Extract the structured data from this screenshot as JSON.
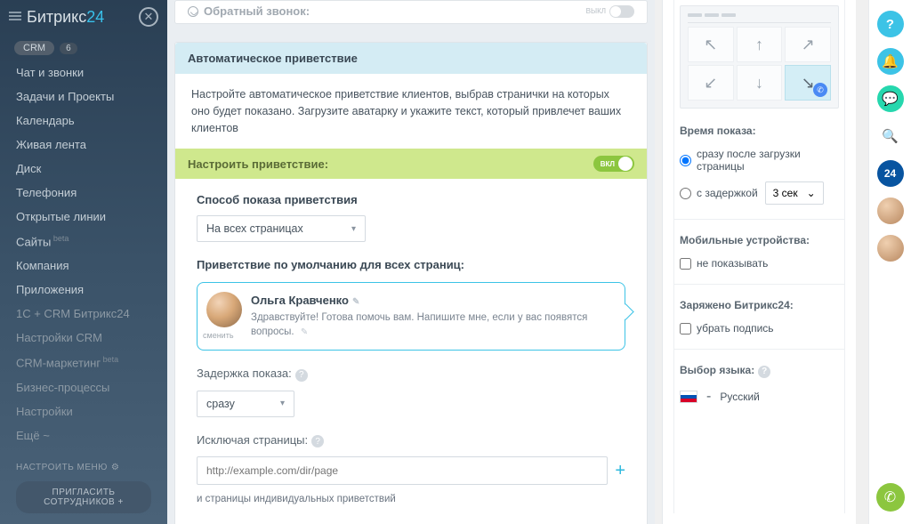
{
  "logo": {
    "brand": "Битрикс",
    "suffix": "24"
  },
  "sidebar": {
    "crm": {
      "label": "CRM",
      "count": "6"
    },
    "items": [
      "Чат и звонки",
      "Задачи и Проекты",
      "Календарь",
      "Живая лента",
      "Диск",
      "Телефония",
      "Открытые линии",
      "Сайты",
      "Компания",
      "Приложения",
      "1С + CRM Битрикс24",
      "Настройки CRM",
      "CRM-маркетинг",
      "Бизнес-процессы",
      "Настройки",
      "Ещё ~"
    ],
    "configure": "НАСТРОИТЬ МЕНЮ",
    "invite": "ПРИГЛАСИТЬ СОТРУДНИКОВ  +"
  },
  "callback": {
    "label": "Обратный звонок:",
    "off": "ВЫКЛ"
  },
  "greeting": {
    "title": "Автоматическое приветствие",
    "desc": "Настройте автоматическое приветствие клиентов, выбрав странички на которых оно будет показано. Загрузите аватарку и укажите текст, который привлечет ваших клиентов",
    "setup_label": "Настроить приветствие:",
    "on": "ВКЛ",
    "method_label": "Способ показа приветствия",
    "method_value": "На всех страницах",
    "default_label": "Приветствие по умолчанию для всех страниц:",
    "agent_name": "Ольга Кравченко",
    "change": "сменить",
    "text": "Здравствуйте! Готова помочь вам. Напишите мне, если у вас появятся вопросы.",
    "delay_label": "Задержка показа:",
    "delay_value": "сразу",
    "exclude_label": "Исключая страницы:",
    "exclude_placeholder": "http://example.com/dir/page",
    "exclude_note": "и страницы индивидуальных приветствий"
  },
  "right": {
    "time_title": "Время показа:",
    "opt_immediate": "сразу после загрузки страницы",
    "opt_delay": "с задержкой",
    "delay_value": "3 сек",
    "mobile_title": "Мобильные устройства:",
    "mobile_hide": "не показывать",
    "powered_title": "Заряжено Битрикс24:",
    "powered_hide": "убрать подпись",
    "lang_title": "Выбор языка:",
    "lang_name": "Русский"
  }
}
